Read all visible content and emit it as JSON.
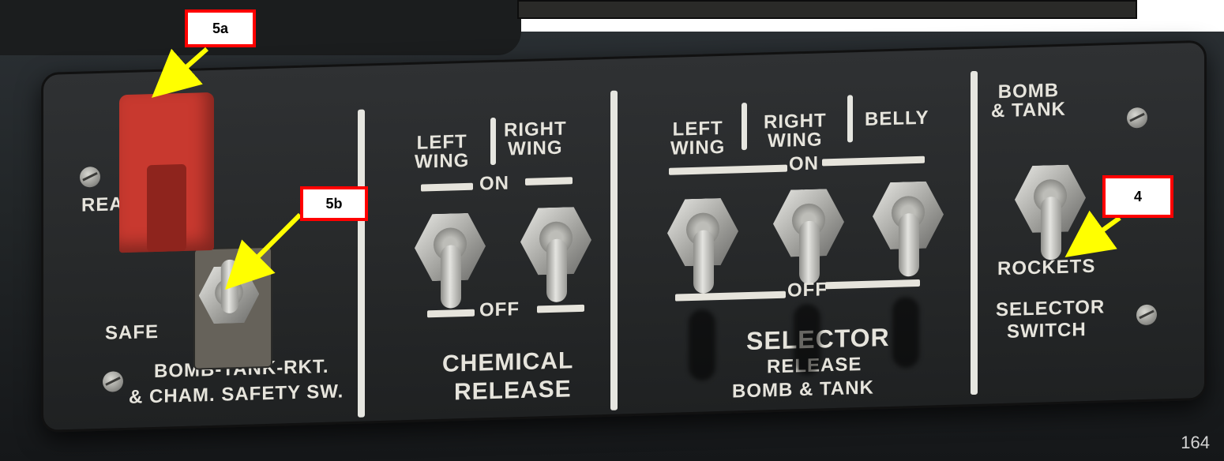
{
  "callouts": {
    "a5": "5a",
    "b5": "5b",
    "c4": "4"
  },
  "safety_section": {
    "ready_label": "READ",
    "safe_label": "SAFE",
    "title_line1": "BOMB-TANK-RKT.",
    "title_line2": "& CHAM. SAFETY SW."
  },
  "chemical_section": {
    "left_label": "LEFT\nWING",
    "right_label": "RIGHT\nWING",
    "on_label": "ON",
    "off_label": "OFF",
    "title_line1": "CHEMICAL",
    "title_line2": "RELEASE"
  },
  "selector_section": {
    "left_label": "LEFT\nWING",
    "right_label": "RIGHT\nWING",
    "belly_label": "BELLY",
    "on_label": "ON",
    "off_label": "OFF",
    "title_line1": "SELECTOR",
    "title_line2": "RELEASE",
    "title_line3": "BOMB & TANK"
  },
  "bomb_rocket_section": {
    "top_label": "BOMB\n& TANK",
    "rockets_label": "ROCKETS",
    "title_line1": "SELECTOR",
    "title_line2": "SWITCH"
  },
  "page_number": "164",
  "colors": {
    "callout_border": "#ff0000",
    "arrow": "#ffff00",
    "guard": "#c8392f",
    "panel": "#2b2d2f",
    "label": "#e6e4dc"
  }
}
